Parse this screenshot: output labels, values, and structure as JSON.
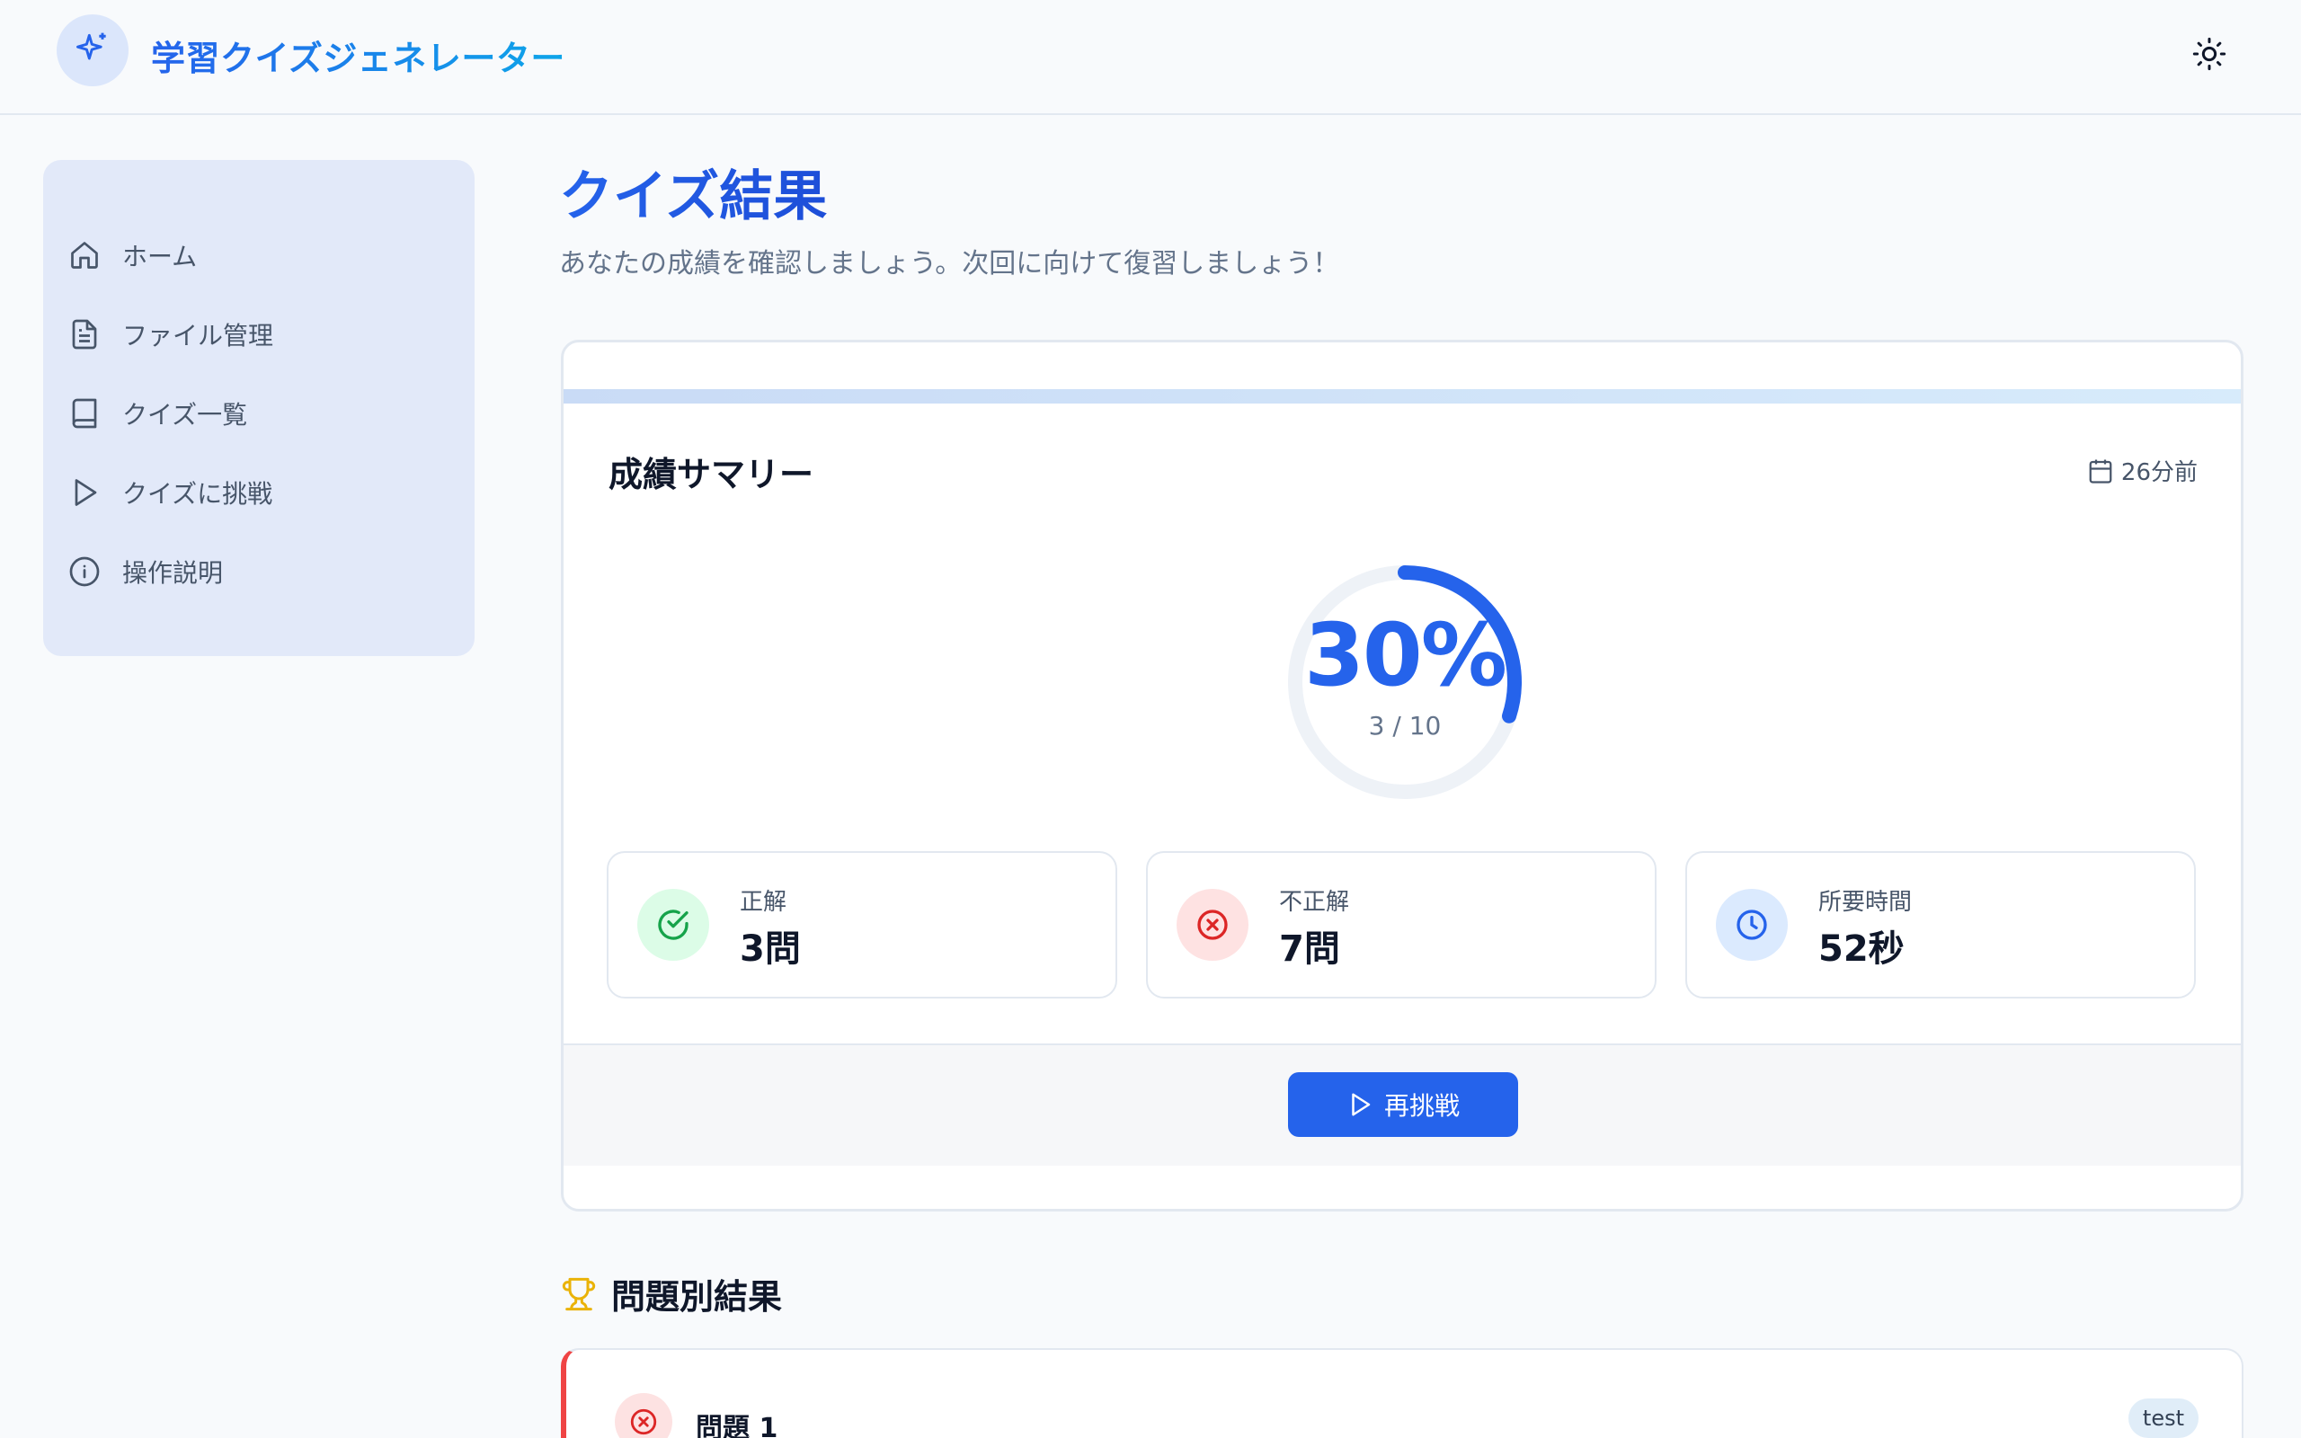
{
  "app": {
    "title": "学習クイズジェネレーター",
    "logo_icon": "sparkles-icon"
  },
  "header": {
    "theme_toggle_icon": "sun-icon"
  },
  "sidebar": {
    "items": [
      {
        "label": "ホーム",
        "icon": "home-icon"
      },
      {
        "label": "ファイル管理",
        "icon": "file-text-icon"
      },
      {
        "label": "クイズ一覧",
        "icon": "book-icon"
      },
      {
        "label": "クイズに挑戦",
        "icon": "play-icon"
      },
      {
        "label": "操作説明",
        "icon": "info-icon"
      }
    ]
  },
  "main": {
    "title": "クイズ結果",
    "subtitle": "あなたの成績を確認しましょう。次回に向けて復習しましょう！",
    "summary": {
      "title": "成績サマリー",
      "date": "26分前",
      "score_percent_label": "30%",
      "score_percent": 30,
      "score_fraction": "3 / 10",
      "stats": [
        {
          "label": "正解",
          "value": "3問",
          "icon": "check-circle-icon",
          "color": "#16a34a",
          "bg": "#dcfce7"
        },
        {
          "label": "不正解",
          "value": "7問",
          "icon": "x-circle-icon",
          "color": "#dc2626",
          "bg": "#fee2e2"
        },
        {
          "label": "所要時間",
          "value": "52秒",
          "icon": "clock-icon",
          "color": "#2563eb",
          "bg": "#dbeafe"
        }
      ],
      "retry_label": "再挑戦"
    },
    "results_heading": "問題別結果",
    "questions": [
      {
        "title": "問題 1",
        "tag": "test",
        "status": "incorrect"
      }
    ]
  },
  "colors": {
    "accent": "#2563eb",
    "incorrect": "#ef4444",
    "correct": "#16a34a"
  }
}
